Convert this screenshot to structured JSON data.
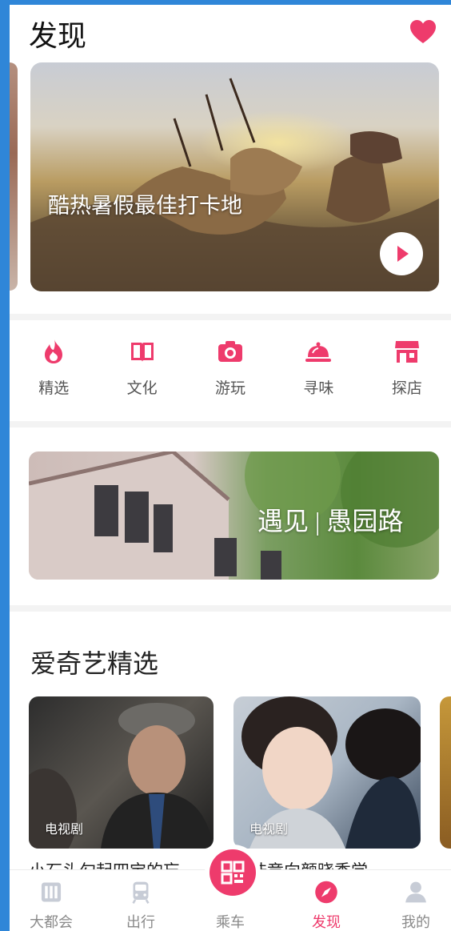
{
  "header": {
    "title": "发现",
    "favorite_icon": "heart-icon"
  },
  "hero": {
    "caption": "酷热暑假最佳打卡地",
    "play_icon": "play-icon"
  },
  "categories": [
    {
      "label": "精选",
      "icon": "flame-icon"
    },
    {
      "label": "文化",
      "icon": "book-icon"
    },
    {
      "label": "游玩",
      "icon": "camera-icon"
    },
    {
      "label": "寻味",
      "icon": "food-cloche-icon"
    },
    {
      "label": "探店",
      "icon": "store-icon"
    }
  ],
  "banner": {
    "caption": "遇见 | 愚园路"
  },
  "iqiyi": {
    "title": "爱奇艺精选",
    "cards": [
      {
        "tag": "电视剧",
        "title": "小石头勾起四宝的忘"
      },
      {
        "tag": "电视剧",
        "title": "悬浩竟向颜晓秀学"
      }
    ]
  },
  "tabbar": {
    "items": [
      {
        "label": "大都会",
        "icon": "metro-app-icon"
      },
      {
        "label": "出行",
        "icon": "train-icon"
      },
      {
        "label": "乘车",
        "icon": "qr-code-icon"
      },
      {
        "label": "发现",
        "icon": "compass-icon",
        "active": true
      },
      {
        "label": "我的",
        "icon": "user-icon"
      }
    ]
  },
  "colors": {
    "accent": "#ee3b6c",
    "tab_inactive": "#8a8a8a",
    "frame": "#2f86d8"
  }
}
